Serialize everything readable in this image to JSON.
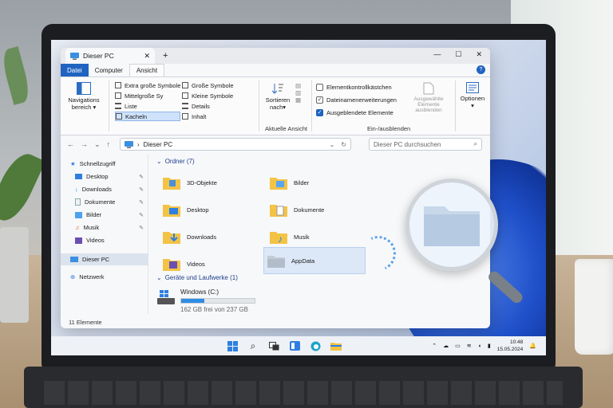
{
  "window": {
    "tab_title": "Dieser PC",
    "new_tab": "+",
    "controls": {
      "minimize": "—",
      "maximize": "☐",
      "close": "✕"
    },
    "close_tab": "✕"
  },
  "ribbon_tabs": {
    "file": "Datei",
    "computer": "Computer",
    "view": "Ansicht",
    "help": "?"
  },
  "ribbon": {
    "nav_pane_1": "Navigations",
    "nav_pane_2": "bereich",
    "layout": {
      "extra_large": "Extra große Symbole",
      "large": "Große Symbole",
      "medium": "Mittelgroße Sy",
      "small": "Kleine Symbole",
      "list": "Liste",
      "details": "Details",
      "tiles": "Kacheln",
      "content": "Inhalt"
    },
    "sort_1": "Sortieren",
    "sort_2": "nach",
    "group_current_view": "Aktuelle Ansicht",
    "checkboxes": {
      "item_checkboxes": "Elementkontrollkästchen",
      "extensions": "Dateinamenerweiterungen",
      "hidden": "Ausgeblendete Elemente"
    },
    "group_show_hide": "Ein-/ausblenden",
    "hide_selected_1": "Ausgewählte",
    "hide_selected_2": "Elemente ausblenden",
    "options": "Optionen"
  },
  "address": {
    "path": "Dieser PC",
    "search_placeholder": "Dieser PC durchsuchen"
  },
  "sidebar": {
    "quick_access": "Schnellzugriff",
    "items": [
      {
        "label": "Desktop"
      },
      {
        "label": "Downloads"
      },
      {
        "label": "Dokumente"
      },
      {
        "label": "Bilder"
      },
      {
        "label": "Musik"
      },
      {
        "label": "Videos"
      }
    ],
    "this_pc": "Dieser PC",
    "network": "Netzwerk"
  },
  "content": {
    "folders_header": "Ordner (7)",
    "folders": [
      {
        "label": "3D-Objekte"
      },
      {
        "label": "Bilder"
      },
      {
        "label": "Desktop"
      },
      {
        "label": "Dokumente"
      },
      {
        "label": "Downloads"
      },
      {
        "label": "Musik"
      },
      {
        "label": "Videos"
      },
      {
        "label": "AppData"
      }
    ],
    "drives_header": "Geräte und Laufwerke (1)",
    "drive": {
      "name": "Windows (C:)",
      "free": "162 GB frei von 237 GB",
      "used_fraction": 0.32
    }
  },
  "status": "11 Elemente",
  "taskbar": {
    "time": "10:48",
    "date": "15.05.2024"
  },
  "colors": {
    "accent": "#2063c0",
    "folder": "#f3c346"
  }
}
